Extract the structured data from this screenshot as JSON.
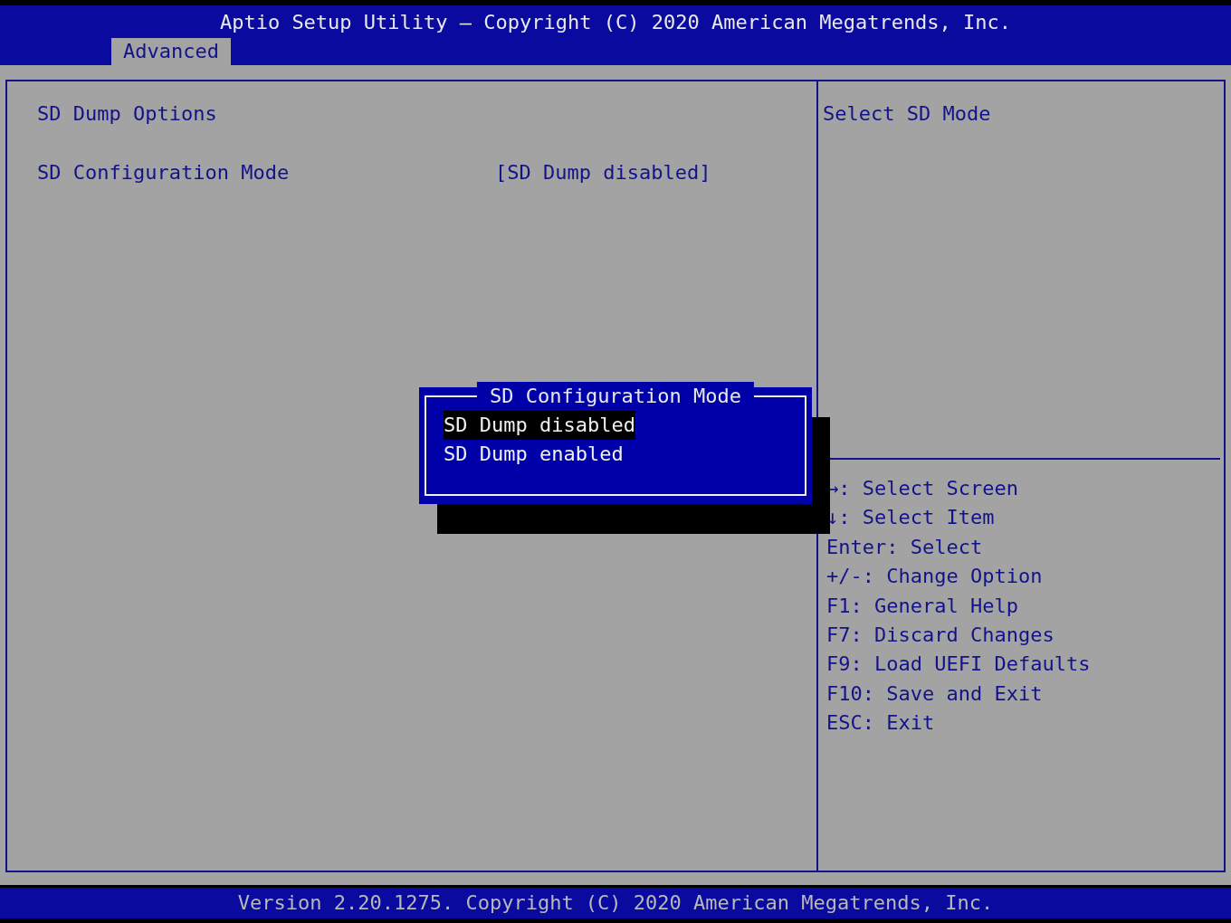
{
  "title": "Aptio Setup Utility – Copyright (C) 2020 American Megatrends, Inc.",
  "tabs": [
    {
      "label": "Advanced",
      "selected": true
    }
  ],
  "main": {
    "heading": "SD Dump Options",
    "settings": [
      {
        "label": "SD Configuration Mode",
        "value": "[SD Dump disabled]"
      }
    ]
  },
  "help_text": "Select SD Mode",
  "key_help": [
    "→: Select Screen",
    "↓: Select Item",
    "Enter: Select",
    "+/-: Change Option",
    "F1: General Help",
    "F7: Discard Changes",
    "F9: Load UEFI Defaults",
    "F10: Save and Exit",
    "ESC: Exit"
  ],
  "popup": {
    "title": "SD Configuration Mode",
    "options": [
      {
        "label": "SD Dump disabled",
        "selected": true
      },
      {
        "label": "SD Dump enabled",
        "selected": false
      }
    ]
  },
  "footer": "Version 2.20.1275. Copyright (C) 2020 American Megatrends, Inc."
}
